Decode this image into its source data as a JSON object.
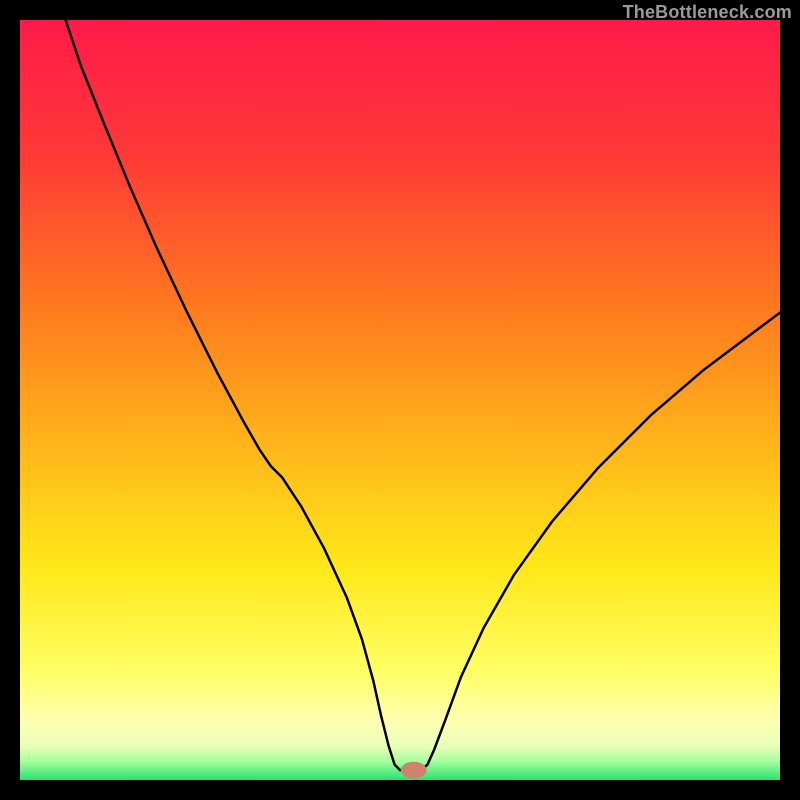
{
  "watermark": "TheBottleneck.com",
  "chart_data": {
    "type": "line",
    "title": "",
    "xlabel": "",
    "ylabel": "",
    "xlim": [
      0,
      100
    ],
    "ylim": [
      0,
      100
    ],
    "grid": false,
    "legend": false,
    "annotations": [],
    "background": {
      "description": "vertical gradient red→orange→yellow→pale-yellow→green bottom band",
      "stops": [
        {
          "offset": 0.0,
          "color": "#ff1a4a"
        },
        {
          "offset": 0.18,
          "color": "#ff3a36"
        },
        {
          "offset": 0.38,
          "color": "#ff7a1f"
        },
        {
          "offset": 0.55,
          "color": "#ffb21a"
        },
        {
          "offset": 0.72,
          "color": "#ffe81a"
        },
        {
          "offset": 0.86,
          "color": "#ffff66"
        },
        {
          "offset": 0.92,
          "color": "#ffffb0"
        },
        {
          "offset": 0.955,
          "color": "#e8ffb8"
        },
        {
          "offset": 0.975,
          "color": "#a8ff9e"
        },
        {
          "offset": 1.0,
          "color": "#27e36f"
        }
      ]
    },
    "marker": {
      "x": 51.8,
      "y": 1.3,
      "color": "#cf836e",
      "rx": 1.7,
      "ry": 1.1
    },
    "series": [
      {
        "name": "bottleneck-curve",
        "stroke": "#000000",
        "stroke_width": 2.5,
        "path_xy": [
          [
            6.0,
            100.0
          ],
          [
            8.0,
            94.0
          ],
          [
            11.0,
            86.5
          ],
          [
            14.5,
            78.0
          ],
          [
            18.0,
            70.0
          ],
          [
            22.0,
            61.5
          ],
          [
            26.0,
            53.5
          ],
          [
            29.5,
            47.0
          ],
          [
            31.5,
            43.5
          ],
          [
            33.0,
            41.3
          ],
          [
            34.5,
            39.8
          ],
          [
            37.0,
            36.0
          ],
          [
            40.0,
            30.5
          ],
          [
            43.0,
            24.0
          ],
          [
            45.0,
            18.5
          ],
          [
            46.5,
            13.0
          ],
          [
            47.5,
            8.5
          ],
          [
            48.5,
            4.5
          ],
          [
            49.3,
            2.0
          ],
          [
            50.0,
            1.3
          ],
          [
            52.8,
            1.3
          ],
          [
            53.6,
            2.0
          ],
          [
            54.5,
            4.0
          ],
          [
            56.0,
            8.0
          ],
          [
            58.0,
            13.5
          ],
          [
            61.0,
            20.0
          ],
          [
            65.0,
            27.0
          ],
          [
            70.0,
            34.0
          ],
          [
            76.0,
            41.0
          ],
          [
            83.0,
            48.0
          ],
          [
            90.0,
            54.0
          ],
          [
            96.0,
            58.5
          ],
          [
            100.0,
            61.5
          ]
        ]
      }
    ]
  }
}
